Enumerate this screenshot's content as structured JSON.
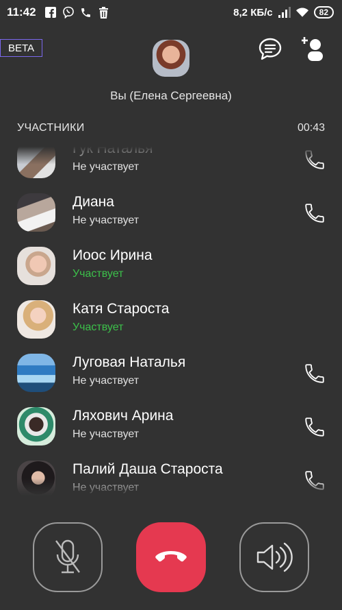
{
  "status_bar": {
    "time": "11:42",
    "speed": "8,2 КБ/с",
    "battery": "82",
    "icons": [
      "facebook-icon",
      "viber-icon",
      "phone-icon",
      "trash-icon",
      "signal-icon",
      "wifi-icon",
      "battery-icon"
    ]
  },
  "header": {
    "beta_label": "BETA",
    "self_name": "Вы (Елена Сергеевна)",
    "section_label": "УЧАСТНИКИ",
    "timer": "00:43"
  },
  "participants": [
    {
      "name": "Гук Наталья",
      "status": "Не участвует",
      "active": false,
      "has_call": true
    },
    {
      "name": "Диана",
      "status": "Не участвует",
      "active": false,
      "has_call": true
    },
    {
      "name": "Иоос Ирина",
      "status": "Участвует",
      "active": true,
      "has_call": false
    },
    {
      "name": "Катя Староста",
      "status": "Участвует",
      "active": true,
      "has_call": false
    },
    {
      "name": "Луговая Наталья",
      "status": "Не участвует",
      "active": false,
      "has_call": true
    },
    {
      "name": "Ляхович Арина",
      "status": "Не участвует",
      "active": false,
      "has_call": true
    },
    {
      "name": "Палий Даша Староста",
      "status": "Не участвует",
      "active": false,
      "has_call": true
    }
  ],
  "colors": {
    "background": "#323232",
    "active_status": "#3cc14a",
    "end_call": "#e53950",
    "beta_border": "#7b68ee"
  }
}
